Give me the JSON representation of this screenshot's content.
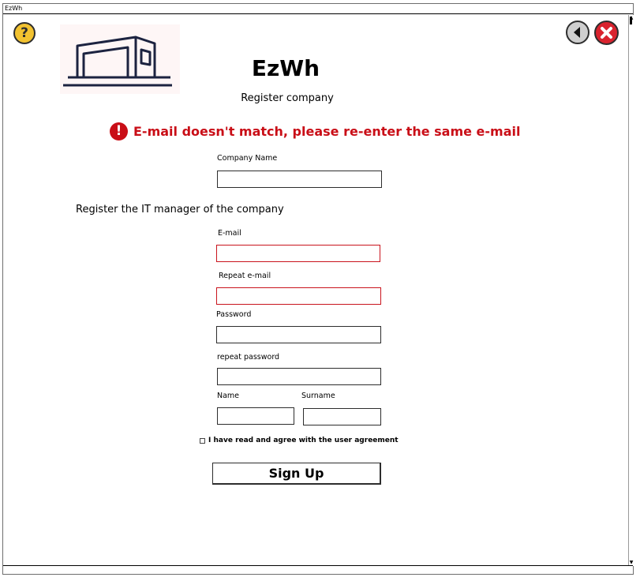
{
  "window": {
    "title": "EzWh"
  },
  "header": {
    "app_name": "EzWh",
    "subtitle": "Register company",
    "help_symbol": "?",
    "help_icon": "question-icon",
    "back_icon": "back-arrow-icon",
    "close_icon": "close-x-icon"
  },
  "error": {
    "icon": "!",
    "message": "E-mail doesn't match, please re-enter the same e-mail",
    "color": "#c90e17"
  },
  "form": {
    "company_name_label": "Company Name",
    "company_name_value": "",
    "section_heading": "Register the IT manager of the company",
    "email_label": "E-mail",
    "email_value": "",
    "repeat_email_label": "Repeat e-mail",
    "repeat_email_value": "",
    "password_label": "Password",
    "password_value": "",
    "repeat_password_label": "repeat password",
    "repeat_password_value": "",
    "name_label": "Name",
    "name_value": "",
    "surname_label": "Surname",
    "surname_value": "",
    "agreement_label": "I have read and agree with the user agreement",
    "agreement_checked": false,
    "signup_label": "Sign Up"
  },
  "colors": {
    "help": "#f2c230",
    "back": "#cfcfcf",
    "close": "#d9232e",
    "error_border": "#c9141d"
  }
}
